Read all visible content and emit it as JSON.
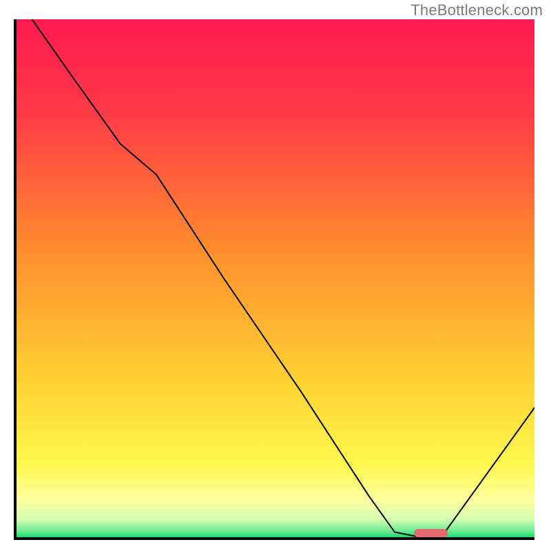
{
  "watermark": "TheBottleneck.com",
  "chart_data": {
    "type": "line",
    "title": "",
    "xlabel": "",
    "ylabel": "",
    "xlim": [
      0,
      100
    ],
    "ylim": [
      0,
      100
    ],
    "grid": false,
    "legend": false,
    "series": [
      {
        "name": "bottleneck-curve",
        "x": [
          3,
          10,
          20,
          27,
          40,
          55,
          68,
          73,
          78,
          82,
          100
        ],
        "y": [
          100,
          90,
          76,
          70,
          50,
          28,
          8,
          1,
          0,
          0,
          25
        ],
        "stroke": "#000000",
        "stroke_width": 2
      }
    ],
    "background_gradient": {
      "stops": [
        {
          "offset": 0.0,
          "color": "#ff1a4f"
        },
        {
          "offset": 0.18,
          "color": "#ff3a47"
        },
        {
          "offset": 0.45,
          "color": "#ff8f2e"
        },
        {
          "offset": 0.7,
          "color": "#ffd233"
        },
        {
          "offset": 0.86,
          "color": "#fff94f"
        },
        {
          "offset": 0.93,
          "color": "#fdffa0"
        },
        {
          "offset": 0.965,
          "color": "#d4ffb0"
        },
        {
          "offset": 0.985,
          "color": "#7aef9a"
        },
        {
          "offset": 1.0,
          "color": "#19de6e"
        }
      ]
    },
    "marker": {
      "x_center": 80,
      "y": 0,
      "width_pct": 6.5,
      "height_pct": 1.6,
      "color": "#e46a6f"
    }
  }
}
